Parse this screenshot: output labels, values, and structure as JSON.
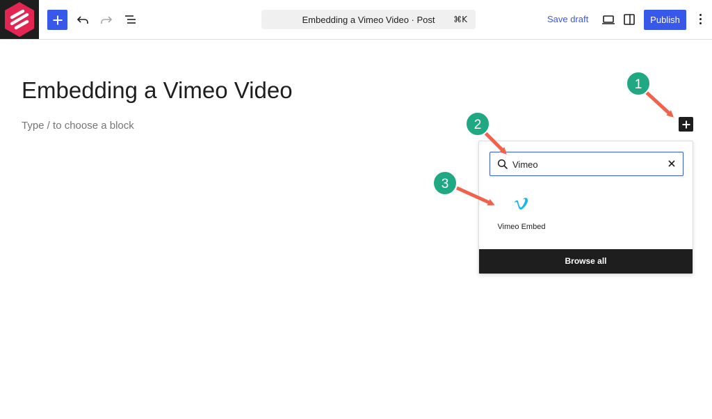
{
  "toolbar": {
    "doc_title": "Embedding a Vimeo Video · Post",
    "shortcut": "⌘K",
    "save_draft": "Save draft",
    "publish": "Publish"
  },
  "editor": {
    "title": "Embedding a Vimeo Video",
    "placeholder": "Type / to choose a block"
  },
  "inserter": {
    "search_value": "Vimeo",
    "result_label": "Vimeo Embed",
    "browse_all": "Browse all"
  },
  "callouts": [
    "1",
    "2",
    "3"
  ],
  "colors": {
    "accent": "#3858e9",
    "logo_bg": "#1e1e1e",
    "logo_red": "#e32651",
    "vimeo": "#1ab7ea",
    "callout_green": "#1fa882",
    "arrow": "#f0624b"
  },
  "icons": [
    "logo-icon",
    "plus-icon",
    "undo-icon",
    "redo-icon",
    "list-view-icon",
    "desktop-preview-icon",
    "sidebar-toggle-icon",
    "more-options-icon",
    "search-icon",
    "close-icon",
    "vimeo-icon"
  ]
}
